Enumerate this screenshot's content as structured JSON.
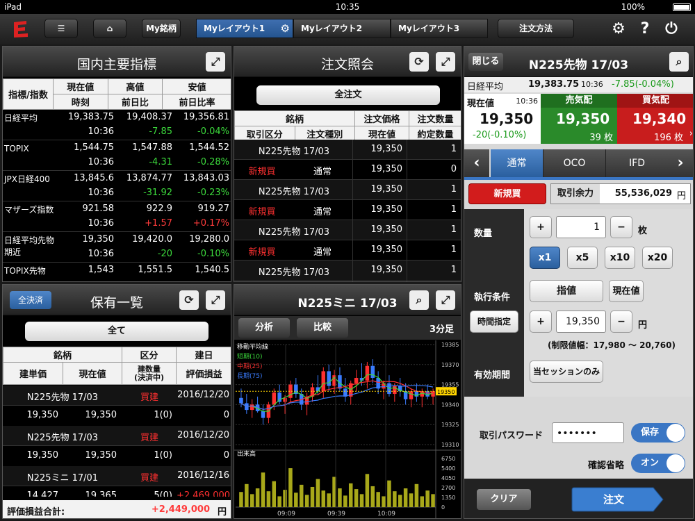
{
  "status": {
    "device": "iPad",
    "time": "10:35",
    "battery": "100%"
  },
  "toolbar": {
    "my_stocks": "My銘柄",
    "layouts": [
      "Myレイアウト1",
      "Myレイアウト2",
      "Myレイアウト3"
    ],
    "order_method": "注文方法"
  },
  "indices": {
    "title": "国内主要指標",
    "headers": [
      [
        "指標/指数",
        "現在値",
        "高値",
        "安値"
      ],
      [
        "時刻",
        "前日比",
        "前日比率"
      ]
    ],
    "rows": [
      {
        "name": "日経平均",
        "price": "19,383.75",
        "high": "19,408.37",
        "low": "19,356.81",
        "time": "10:36",
        "chg": "-7.85",
        "pct": "-0.04%",
        "dir": "down"
      },
      {
        "name": "TOPIX",
        "price": "1,544.75",
        "high": "1,547.88",
        "low": "1,544.52",
        "time": "10:36",
        "chg": "-4.31",
        "pct": "-0.28%",
        "dir": "down"
      },
      {
        "name": "JPX日経400",
        "price": "13,845.6",
        "high": "13,874.77",
        "low": "13,843.03",
        "time": "10:36",
        "chg": "-31.92",
        "pct": "-0.23%",
        "dir": "down"
      },
      {
        "name": "マザーズ指数",
        "price": "921.58",
        "high": "922.9",
        "low": "919.27",
        "time": "10:36",
        "chg": "+1.57",
        "pct": "+0.17%",
        "dir": "up"
      },
      {
        "name": "日経平均先物 期近",
        "price": "19,350",
        "high": "19,420.0",
        "low": "19,280.0",
        "time": "10:36",
        "chg": "-20",
        "pct": "-0.10%",
        "dir": "down"
      },
      {
        "name": "TOPIX先物",
        "price": "1,543",
        "high": "1,551.5",
        "low": "1,540.5",
        "time": "",
        "chg": "",
        "pct": "",
        "dir": "down"
      }
    ]
  },
  "orders": {
    "title": "注文照会",
    "all_label": "全注文",
    "headers": [
      [
        "銘柄",
        "注文価格",
        "注文数量"
      ],
      [
        "取引区分",
        "注文種別",
        "現在値",
        "約定数量"
      ]
    ],
    "rows": [
      {
        "name": "N225先物 17/03",
        "price": "19,350",
        "qty": "1",
        "side": "新規買",
        "type": "通常",
        "cur": "19,350",
        "filled": "0"
      },
      {
        "name": "N225先物 17/03",
        "price": "19,350",
        "qty": "1",
        "side": "新規買",
        "type": "通常",
        "cur": "19,350",
        "filled": "1"
      },
      {
        "name": "N225先物 17/03",
        "price": "19,350",
        "qty": "1",
        "side": "新規買",
        "type": "通常",
        "cur": "19,350",
        "filled": "1"
      },
      {
        "name": "N225先物 17/03",
        "price": "19,350",
        "qty": "1",
        "side": "",
        "type": "",
        "cur": "",
        "filled": ""
      }
    ]
  },
  "holdings": {
    "title": "保有一覧",
    "settle_all": "全決済",
    "all_label": "全て",
    "headers": [
      [
        "銘柄",
        "区分",
        "建日"
      ],
      [
        "建単価",
        "現在値",
        "建数量\n(決済中)",
        "評価損益"
      ]
    ],
    "rows": [
      {
        "name": "N225先物 17/03",
        "side": "買建",
        "date": "2016/12/20",
        "unit": "19,350",
        "cur": "19,350",
        "qty": "1(0)",
        "pl": "0"
      },
      {
        "name": "N225先物 17/03",
        "side": "買建",
        "date": "2016/12/20",
        "unit": "19,350",
        "cur": "19,350",
        "qty": "1(0)",
        "pl": "0"
      },
      {
        "name": "N225ミニ 17/01",
        "side": "買建",
        "date": "2016/12/16",
        "unit": "14,427",
        "cur": "19,365",
        "qty": "5(0)",
        "pl": "+2,469,000"
      }
    ],
    "total_label": "評価損益合計:",
    "total_value": "+2,449,000",
    "total_unit": "円"
  },
  "chart": {
    "title": "N225ミニ 17/03",
    "btn_analysis": "分析",
    "btn_compare": "比較",
    "interval": "3分足",
    "ma_title": "移動平均線",
    "ma_short": "短期(10)",
    "ma_mid": "中期(25)",
    "ma_long": "長期(75)",
    "volume_label": "出来高",
    "price_ticks": [
      "19385",
      "19370",
      "19355",
      "19340",
      "19325",
      "19310"
    ],
    "last_price": "19350",
    "vol_ticks": [
      "6750",
      "5400",
      "4050",
      "2700",
      "1350",
      "0"
    ],
    "time_ticks": [
      "09:09",
      "09:39",
      "10:09"
    ],
    "colors": {
      "up": "#ff3030",
      "down": "#3a7cff",
      "short": "#3cdc3c",
      "mid": "#ff3030",
      "long": "#3a7cff",
      "vol": "#a8a81a"
    }
  },
  "chart_data": {
    "type": "candlestick",
    "title": "N225ミニ 17/03",
    "ylim": [
      19310,
      19385
    ],
    "candles": [
      [
        19345,
        19352,
        19338,
        19341
      ],
      [
        19341,
        19348,
        19333,
        19336
      ],
      [
        19336,
        19344,
        19330,
        19340
      ],
      [
        19340,
        19346,
        19334,
        19335
      ],
      [
        19335,
        19340,
        19325,
        19330
      ],
      [
        19330,
        19342,
        19326,
        19340
      ],
      [
        19340,
        19352,
        19336,
        19349
      ],
      [
        19349,
        19355,
        19340,
        19342
      ],
      [
        19342,
        19347,
        19333,
        19345
      ],
      [
        19345,
        19358,
        19341,
        19355
      ],
      [
        19355,
        19360,
        19345,
        19348
      ],
      [
        19348,
        19352,
        19336,
        19340
      ],
      [
        19340,
        19349,
        19332,
        19346
      ],
      [
        19346,
        19356,
        19342,
        19353
      ],
      [
        19353,
        19362,
        19347,
        19350
      ],
      [
        19350,
        19368,
        19345,
        19365
      ],
      [
        19365,
        19370,
        19350,
        19354
      ],
      [
        19354,
        19366,
        19348,
        19362
      ],
      [
        19362,
        19368,
        19350,
        19352
      ],
      [
        19352,
        19360,
        19342,
        19346
      ],
      [
        19346,
        19358,
        19340,
        19356
      ],
      [
        19356,
        19366,
        19350,
        19360
      ],
      [
        19360,
        19371,
        19354,
        19358
      ],
      [
        19358,
        19372,
        19352,
        19369
      ],
      [
        19369,
        19374,
        19356,
        19360
      ],
      [
        19360,
        19365,
        19348,
        19352
      ],
      [
        19352,
        19358,
        19344,
        19356
      ],
      [
        19356,
        19362,
        19346,
        19348
      ],
      [
        19348,
        19356,
        19342,
        19354
      ],
      [
        19354,
        19360,
        19346,
        19350
      ],
      [
        19350,
        19356,
        19340,
        19344
      ],
      [
        19344,
        19352,
        19338,
        19350
      ],
      [
        19350,
        19356,
        19342,
        19346
      ],
      [
        19346,
        19352,
        19338,
        19350
      ],
      [
        19350,
        19355,
        19344,
        19346
      ],
      [
        19346,
        19352,
        19340,
        19350
      ]
    ],
    "volume": [
      2100,
      3200,
      1800,
      2600,
      4800,
      2200,
      3600,
      1500,
      2400,
      5400,
      2000,
      3100,
      1700,
      2800,
      3900,
      2300,
      1900,
      4200,
      2600,
      1600,
      3300,
      2500,
      1800,
      4600,
      2900,
      2100,
      1500,
      3700,
      2200,
      1700,
      2600,
      1900,
      3200,
      1500,
      2300,
      1800
    ]
  },
  "right": {
    "close": "閉じる",
    "title": "N225先物 17/03",
    "nikkei_label": "日経平均",
    "nikkei_price": "19,383.75",
    "nikkei_time": "10:36",
    "nikkei_chg": "-7.85(-0.04%)",
    "cur_label": "現在値",
    "cur_time": "10:36",
    "cur_price": "19,350",
    "cur_chg": "-20(-0.10%)",
    "ask_label": "売気配",
    "ask_price": "19,350",
    "ask_qty": "39 枚",
    "bid_label": "買気配",
    "bid_price": "19,340",
    "bid_qty": "196 枚",
    "tabs": [
      "通常",
      "OCO",
      "IFD"
    ],
    "new_buy": "新規買",
    "margin_label": "取引余力",
    "margin_value": "55,536,029",
    "yen": "円",
    "qty_label": "数量",
    "qty_value": "1",
    "qty_unit": "枚",
    "multipliers": [
      "x1",
      "x5",
      "x10",
      "x20"
    ],
    "cond_label": "執行条件",
    "limit": "指値",
    "market": "現在値",
    "time_spec": "時間指定",
    "price_value": "19,350",
    "price_range": "(制限値幅：17,980 〜 20,760)",
    "validity_label": "有効期間",
    "validity_value": "当セッションのみ",
    "pw_label": "取引パスワード",
    "pw_value": "•••••••",
    "save": "保存",
    "confirm_label": "確認省略",
    "confirm_toggle": "オン",
    "clear": "クリア",
    "order": "注文"
  }
}
